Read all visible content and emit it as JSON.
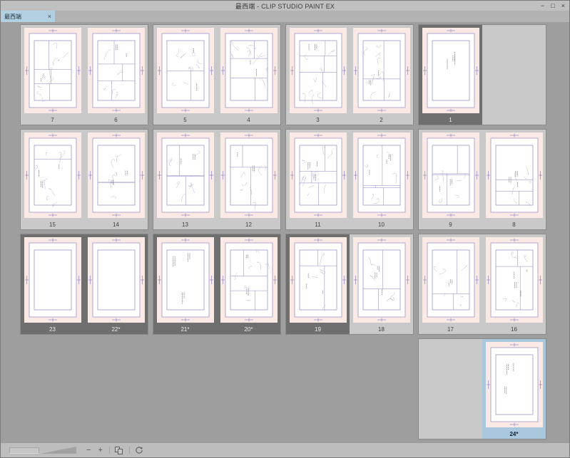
{
  "window": {
    "title": "最西端 - CLIP STUDIO PAINT EX",
    "minimize": "−",
    "maximize": "□",
    "close": "×"
  },
  "tab": {
    "label": "最西端",
    "close": "×"
  },
  "statusbar": {
    "zoom_out": "−",
    "zoom_in": "+"
  },
  "colors": {
    "canvas_bg": "#9e9e9e",
    "spread_bg": "#c9c9c9",
    "selected_bg": "#6f6f6f",
    "current_bg": "#a9c7dd",
    "page_pink": "#fbe9e6",
    "guide_purple": "#9088c5",
    "tab_blue": "#b3cfe2",
    "titlebar_bg": "#c0c0c0"
  },
  "pages": {
    "rows": [
      {
        "spreads": [
          {
            "cells": [
              {
                "label": "7",
                "state": "normal",
                "content": "sketch"
              },
              {
                "label": "6",
                "state": "normal",
                "content": "sketch"
              }
            ]
          },
          {
            "cells": [
              {
                "label": "5",
                "state": "normal",
                "content": "sketch"
              },
              {
                "label": "4",
                "state": "normal",
                "content": "sketch"
              }
            ]
          },
          {
            "cells": [
              {
                "label": "3",
                "state": "normal",
                "content": "sketch"
              },
              {
                "label": "2",
                "state": "normal",
                "content": "sketch"
              }
            ]
          },
          {
            "cells": [
              {
                "label": "1",
                "state": "selected",
                "content": "marks"
              },
              {
                "empty": true
              }
            ]
          }
        ]
      },
      {
        "spreads": [
          {
            "cells": [
              {
                "label": "15",
                "state": "normal",
                "content": "sketch"
              },
              {
                "label": "14",
                "state": "normal",
                "content": "sketch"
              }
            ]
          },
          {
            "cells": [
              {
                "label": "13",
                "state": "normal",
                "content": "sketch"
              },
              {
                "label": "12",
                "state": "normal",
                "content": "sketch"
              }
            ]
          },
          {
            "cells": [
              {
                "label": "11",
                "state": "normal",
                "content": "sketch"
              },
              {
                "label": "10",
                "state": "normal",
                "content": "sketch"
              }
            ]
          },
          {
            "cells": [
              {
                "label": "9",
                "state": "normal",
                "content": "sketch"
              },
              {
                "label": "8",
                "state": "normal",
                "content": "sketch"
              }
            ]
          }
        ]
      },
      {
        "spreads": [
          {
            "cells": [
              {
                "label": "23",
                "state": "selected",
                "content": "blank"
              },
              {
                "label": "22*",
                "state": "selected",
                "content": "blank"
              }
            ]
          },
          {
            "cells": [
              {
                "label": "21*",
                "state": "selected",
                "content": "marks"
              },
              {
                "label": "20*",
                "state": "selected",
                "content": "sketch"
              }
            ]
          },
          {
            "cells": [
              {
                "label": "19",
                "state": "selected",
                "content": "sketch"
              },
              {
                "label": "18",
                "state": "normal",
                "content": "sketch"
              }
            ]
          },
          {
            "cells": [
              {
                "label": "17",
                "state": "normal",
                "content": "sketch"
              },
              {
                "label": "16",
                "state": "normal",
                "content": "sketch"
              }
            ]
          }
        ]
      },
      {
        "align": "end",
        "spreads": [
          {
            "cells": [
              {
                "empty": true
              },
              {
                "label": "24*",
                "state": "current",
                "content": "marks"
              }
            ]
          }
        ]
      }
    ]
  }
}
